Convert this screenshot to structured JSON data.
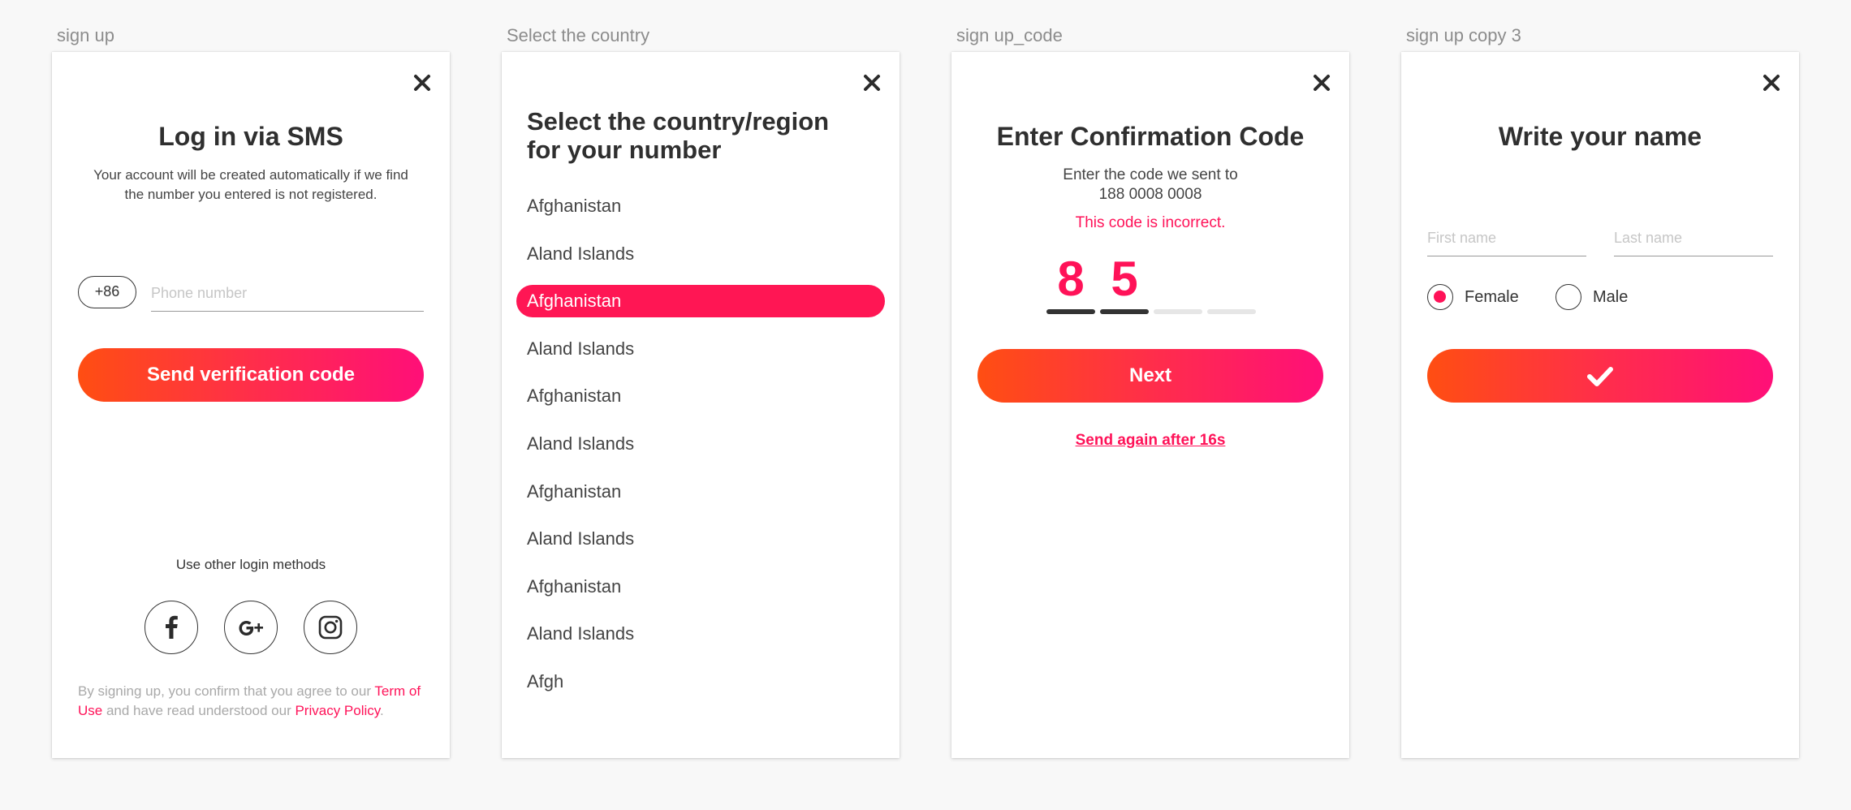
{
  "artboards": {
    "signup_label": "sign up",
    "country_label": "Select the country",
    "code_label": "sign up_code",
    "name_label": "sign up copy 3"
  },
  "signup": {
    "title": "Log in via SMS",
    "subtitle": "Your account will be created automatically if we find the number you entered is not registered.",
    "country_code": "+86",
    "phone_placeholder": "Phone number",
    "send_button": "Send verification code",
    "other_methods": "Use other login methods",
    "social_icons": [
      "facebook-icon",
      "google-plus-icon",
      "instagram-icon"
    ],
    "terms_prefix": "By signing up, you confirm that you agree to our ",
    "terms_link": "Term of Use",
    "terms_middle": " and have read understood our ",
    "privacy_link": "Privacy Policy",
    "terms_suffix": "."
  },
  "country": {
    "title": "Select the country/region for your number",
    "items": [
      "Afghanistan",
      "Aland Islands",
      "Afghanistan",
      "Aland Islands",
      "Afghanistan",
      "Aland Islands",
      "Afghanistan",
      "Aland Islands",
      "Afghanistan",
      "Aland Islands",
      "Afgh"
    ],
    "selected_index": 2
  },
  "code": {
    "title": "Enter Confirmation Code",
    "subtitle_line1": "Enter the code we sent to",
    "phone": "188 0008 0008",
    "error": "This code is incorrect.",
    "digits": [
      "8",
      "5",
      "",
      ""
    ],
    "next_button": "Next",
    "resend": "Send again after 16s"
  },
  "name": {
    "title": "Write your name",
    "first_placeholder": "First name",
    "last_placeholder": "Last name",
    "female_label": "Female",
    "male_label": "Male",
    "selected_gender": "Female",
    "confirm_icon": "checkmark-icon"
  },
  "colors": {
    "accent": "#ff1258",
    "gradient_start": "#ff4e12",
    "gradient_end": "#ff0f78"
  }
}
